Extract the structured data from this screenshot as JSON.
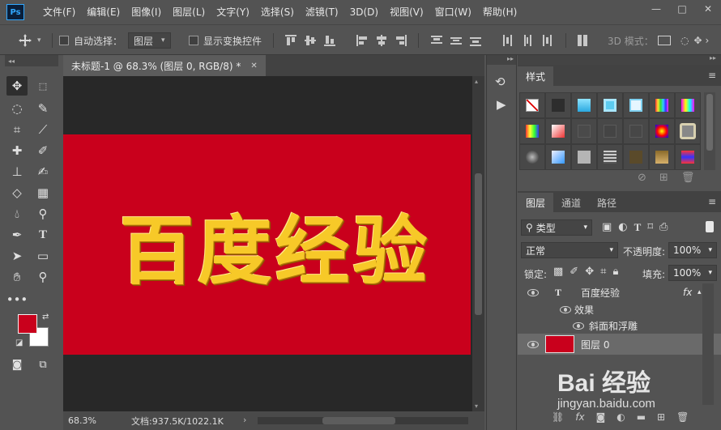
{
  "menu": {
    "logo": "Ps",
    "items": [
      "文件(F)",
      "编辑(E)",
      "图像(I)",
      "图层(L)",
      "文字(Y)",
      "选择(S)",
      "滤镜(T)",
      "3D(D)",
      "视图(V)",
      "窗口(W)",
      "帮助(H)"
    ],
    "window_controls": [
      "—",
      "□",
      "✕"
    ]
  },
  "options": {
    "auto_select_label": "自动选择：",
    "auto_select_value": "图层",
    "show_transform_label": "显示变换控件",
    "mode_3d_label": "3D 模式："
  },
  "document": {
    "tab_title": "未标题-1 @ 68.3% (图层 0, RGB/8) *",
    "tab_close": "✕",
    "canvas_text": "百度经验",
    "zoom": "68.3%",
    "doc_info": "文档:937.5K/1022.1K",
    "canvas_color": "#c9001c"
  },
  "toolbar": {
    "foreground_color": "#c9001c",
    "background_color": "#ffffff"
  },
  "styles_panel": {
    "title": "样式"
  },
  "layers_panel": {
    "tabs": [
      "图层",
      "通道",
      "路径"
    ],
    "filter_label": "类型",
    "blend_mode": "正常",
    "opacity_label": "不透明度:",
    "opacity_value": "100%",
    "lock_label": "锁定:",
    "fill_label": "填充:",
    "fill_value": "100%",
    "layers": [
      {
        "name": "百度经验",
        "fx": "fx"
      },
      {
        "name": "效果"
      },
      {
        "name": "斜面和浮雕"
      },
      {
        "name": "图层 0"
      }
    ]
  },
  "watermark": {
    "logo_text": "Bai 经验",
    "url": "jingyan.baidu.com"
  }
}
